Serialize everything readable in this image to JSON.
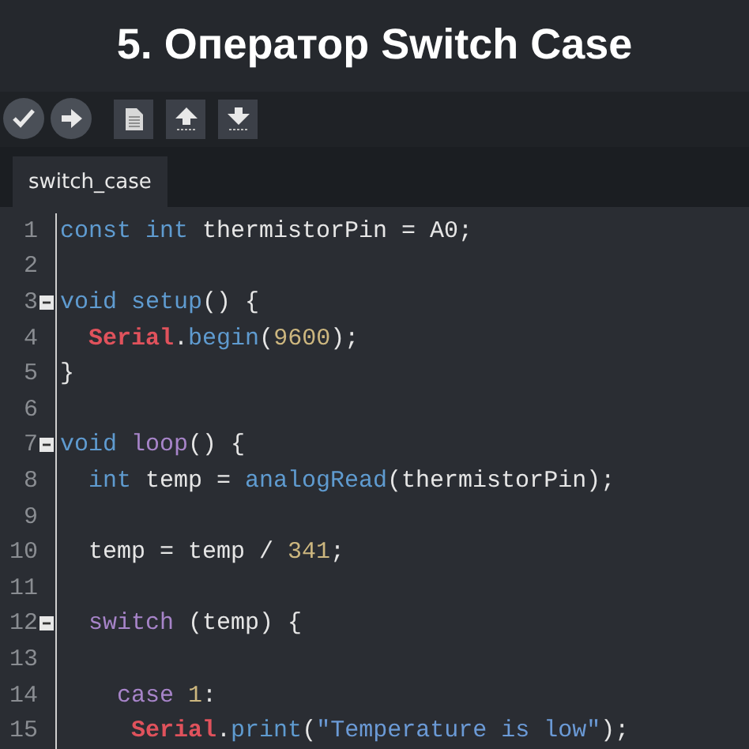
{
  "heading": "5. Оператор Switch Case",
  "toolbar": [
    {
      "kind": "verify"
    },
    {
      "kind": "upload"
    },
    {
      "kind": "new"
    },
    {
      "kind": "open"
    },
    {
      "kind": "save"
    }
  ],
  "tabs": [
    {
      "label": "switch_case",
      "selected": true
    }
  ],
  "code_lines": [
    {
      "number": "1",
      "fold": false,
      "tokens": [
        {
          "t": "const",
          "color": "#5f9bd0"
        },
        {
          "t": " int",
          "color": "#5f9bd0"
        },
        {
          "t": " thermistorPin = A0;"
        }
      ]
    },
    {
      "number": "2",
      "fold": false
    },
    {
      "number": "3",
      "fold": true,
      "tokens": [
        {
          "t": "void",
          "color": "#5f9bd0"
        },
        {
          "t": " setup",
          "color": "#5f9bd0"
        },
        {
          "t": "() {"
        }
      ]
    },
    {
      "number": "4",
      "fold": false,
      "tokens": [
        {
          "t": "  Serial",
          "color": "#e0525c"
        },
        {
          "t": "."
        },
        {
          "t": "begin",
          "color": "#5f9bd0"
        },
        {
          "t": "("
        },
        {
          "t": "9600",
          "color": "#cdb77f"
        },
        {
          "t": ");"
        }
      ]
    },
    {
      "number": "5",
      "fold": false,
      "tokens": [
        {
          "t": "}"
        }
      ]
    },
    {
      "number": "6",
      "fold": false
    },
    {
      "number": "7",
      "fold": true,
      "tokens": [
        {
          "t": "void",
          "color": "#5f9bd0"
        },
        {
          "t": " loop",
          "color": "#a784c9"
        },
        {
          "t": "() {"
        }
      ]
    },
    {
      "number": "8",
      "fold": false,
      "tokens": [
        {
          "t": "  int",
          "color": "#5f9bd0"
        },
        {
          "t": " temp = "
        },
        {
          "t": "analogRead",
          "color": "#5f9bd0"
        },
        {
          "t": "(thermistorPin);"
        }
      ]
    },
    {
      "number": "9",
      "fold": false
    },
    {
      "number": "10",
      "fold": false,
      "tokens": [
        {
          "t": "  temp = temp / "
        },
        {
          "t": "341",
          "color": "#cdb77f"
        },
        {
          "t": ";"
        }
      ]
    },
    {
      "number": "11",
      "fold": false
    },
    {
      "number": "12",
      "fold": true,
      "tokens": [
        {
          "t": "  switch",
          "color": "#a784c9"
        },
        {
          "t": " (temp) {"
        }
      ]
    },
    {
      "number": "13",
      "fold": false
    },
    {
      "number": "14",
      "fold": false,
      "tokens": [
        {
          "t": "    case",
          "color": "#a784c9"
        },
        {
          "t": " 1",
          "color": "#cdb77f"
        },
        {
          "t": ":"
        }
      ]
    },
    {
      "number": "15",
      "fold": false,
      "tokens": [
        {
          "t": "     Serial",
          "color": "#e0525c"
        },
        {
          "t": "."
        },
        {
          "t": "print",
          "color": "#5f9bd0"
        },
        {
          "t": "("
        },
        {
          "t": "\"Temperature is low\"",
          "color": "#6b9ad6"
        },
        {
          "t": ");"
        }
      ]
    }
  ]
}
